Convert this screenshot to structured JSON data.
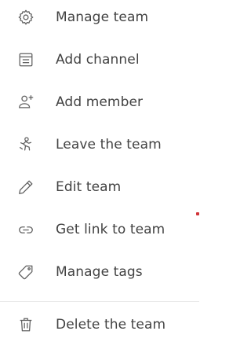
{
  "menu": {
    "items": [
      {
        "label": "Manage team",
        "icon": "gear-icon"
      },
      {
        "label": "Add channel",
        "icon": "channel-icon"
      },
      {
        "label": "Add member",
        "icon": "add-person-icon"
      },
      {
        "label": "Leave the team",
        "icon": "leave-person-icon"
      },
      {
        "label": "Edit team",
        "icon": "pencil-icon"
      },
      {
        "label": "Get link to team",
        "icon": "link-icon"
      },
      {
        "label": "Manage tags",
        "icon": "tag-icon"
      },
      {
        "label": "Delete the team",
        "icon": "trash-icon"
      }
    ]
  },
  "colors": {
    "text": "#424242",
    "icon": "#616161",
    "separator": "#eaeaea",
    "accent": "#d13438"
  }
}
